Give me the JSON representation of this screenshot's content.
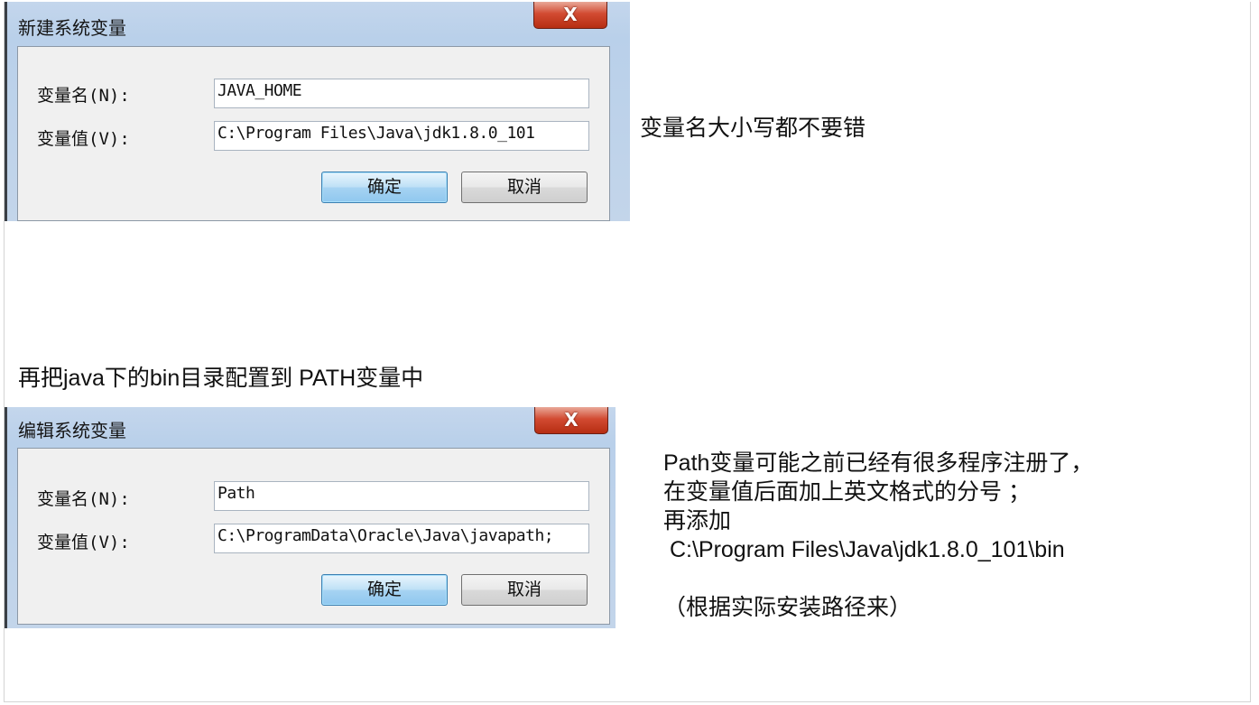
{
  "dialog_new": {
    "title": "新建系统变量",
    "close_glyph": "X",
    "name_label": "变量名(N):",
    "value_label": "变量值(V):",
    "name_value": "JAVA_HOME",
    "value_value": "C:\\Program Files\\Java\\jdk1.8.0_101",
    "ok_label": "确定",
    "cancel_label": "取消"
  },
  "dialog_edit": {
    "title": "编辑系统变量",
    "close_glyph": "X",
    "name_label": "变量名(N):",
    "value_label": "变量值(V):",
    "name_value": "Path",
    "value_value": "C:\\ProgramData\\Oracle\\Java\\javapath;",
    "ok_label": "确定",
    "cancel_label": "取消"
  },
  "notes": {
    "case_note": "变量名大小写都不要错",
    "path_intro": "再把java下的bin目录配置到 PATH变量中",
    "path_lines": [
      "Path变量可能之前已经有很多程序注册了，",
      "在变量值后面加上英文格式的分号 ；",
      "再添加",
      " C:\\Program Files\\Java\\jdk1.8.0_101\\bin",
      "",
      "（根据实际安装路径来）"
    ]
  },
  "colors": {
    "dialog_frame": "#b9d0ea",
    "close_button": "#c7432a",
    "primary_button": "#a6d3f2"
  }
}
